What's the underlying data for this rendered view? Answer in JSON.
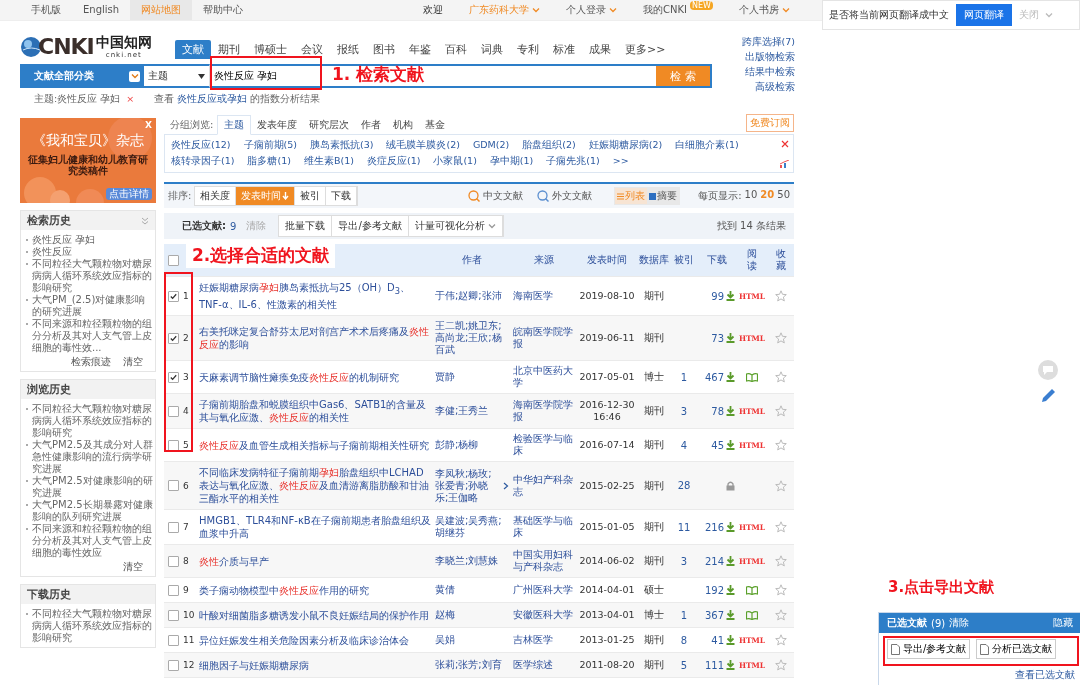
{
  "top_bar": {
    "left": [
      {
        "label": "手机版",
        "selected": false
      },
      {
        "label": "English",
        "selected": false
      },
      {
        "label": "网站地图",
        "selected": true
      },
      {
        "label": "帮助中心",
        "selected": false
      }
    ],
    "welcome": "欢迎",
    "right": [
      {
        "label": "广东药科大学",
        "kind": "org"
      },
      {
        "label": "个人登录",
        "kind": "menu"
      },
      {
        "label": "我的CNKI",
        "kind": "badge",
        "badge": "NEW"
      },
      {
        "label": "个人书房",
        "kind": "menu"
      }
    ]
  },
  "translate_bar": {
    "prompt": "是否将当前网页翻译成中文",
    "button": "网页翻译",
    "close": "关闭"
  },
  "logo": {
    "mark": "CNKI",
    "name": "中国知网",
    "domain": "cnki.net"
  },
  "nav_tabs": [
    {
      "label": "文献",
      "selected": true
    },
    {
      "label": "期刊",
      "selected": false
    },
    {
      "label": "博硕士",
      "selected": false
    },
    {
      "label": "会议",
      "selected": false
    },
    {
      "label": "报纸",
      "selected": false
    },
    {
      "label": "图书",
      "selected": false
    },
    {
      "label": "年鉴",
      "selected": false
    },
    {
      "label": "百科",
      "selected": false
    },
    {
      "label": "词典",
      "selected": false
    },
    {
      "label": "专利",
      "selected": false
    },
    {
      "label": "标准",
      "selected": false
    },
    {
      "label": "成果",
      "selected": false
    },
    {
      "label": "更多>>",
      "selected": false
    }
  ],
  "side_links": [
    "跨库选择(7)",
    "出版物检索",
    "结果中检索",
    "高级检索"
  ],
  "search": {
    "category": "文献全部分类",
    "field": "主题",
    "value": "炎性反应 孕妇",
    "button": "检 索"
  },
  "query_line": {
    "tag": "主题:炎性反应 孕妇",
    "remove": "×",
    "prefix": "查看",
    "link": "炎性反应或孕妇",
    "suffix": "的指数分析结果"
  },
  "ad": {
    "title": "《我和宝贝》杂志",
    "subtitle": "征集妇儿健康和幼儿教育研究类稿件",
    "button": "点击详情",
    "close": "X"
  },
  "history_panels": [
    {
      "title": "检索历史",
      "collapsible": true,
      "items": [
        "炎性反应 孕妇",
        "炎性反应",
        "不同粒径大气颗粒物对糖尿病病人循环系统效应指标的影响研究",
        "大气PM_(2.5)对健康影响的研究进展",
        "不同来源和粒径颗粒物的组分分析及其对人支气管上皮细胞的毒性效..."
      ],
      "footer": [
        "检索痕迹",
        "清空"
      ]
    },
    {
      "title": "浏览历史",
      "collapsible": false,
      "items": [
        "不同粒径大气颗粒物对糖尿病病人循环系统效应指标的影响研究",
        "大气PM2.5及其成分对人群急性健康影响的流行病学研究进展",
        "大气PM2.5对健康影响的研究进展",
        "大气PM2.5长期暴露对健康影响的队列研究进展",
        "不同来源和粒径颗粒物的组分分析及其对人支气管上皮细胞的毒性效应"
      ],
      "footer": [
        "清空"
      ]
    },
    {
      "title": "下载历史",
      "collapsible": false,
      "items": [
        "不同粒径大气颗粒物对糖尿病病人循环系统效应指标的影响研究"
      ]
    }
  ],
  "group_browse": {
    "label": "分组浏览:",
    "tabs": [
      {
        "label": "主题",
        "selected": true
      },
      {
        "label": "发表年度",
        "selected": false
      },
      {
        "label": "研究层次",
        "selected": false
      },
      {
        "label": "作者",
        "selected": false
      },
      {
        "label": "机构",
        "selected": false
      },
      {
        "label": "基金",
        "selected": false
      }
    ],
    "subscribe": "免费订阅",
    "tags": [
      "炎性反应(12)",
      "子痫前期(5)",
      "胰岛素抵抗(3)",
      "绒毛膜羊膜炎(2)",
      "GDM(2)",
      "胎盘组织(2)",
      "妊娠期糖尿病(2)",
      "白细胞介素(1)",
      "核转录因子(1)",
      "脂多糖(1)",
      "维生素B(1)",
      "炎症反应(1)",
      "小家鼠(1)",
      "孕中期(1)",
      "子痫先兆(1)"
    ],
    "more": ">>"
  },
  "sort_bar": {
    "label": "排序:",
    "options": [
      {
        "label": "相关度",
        "selected": false
      },
      {
        "label": "发表时间",
        "selected": true
      },
      {
        "label": "被引",
        "selected": false
      },
      {
        "label": "下载",
        "selected": false
      }
    ],
    "sources": [
      "中文文献",
      "外文文献"
    ],
    "views": [
      {
        "label": "列表",
        "selected": true
      },
      {
        "label": "摘要",
        "selected": false
      }
    ],
    "page_size_label": "每页显示:",
    "page_sizes": [
      {
        "label": "10",
        "selected": false
      },
      {
        "label": "20",
        "selected": true
      },
      {
        "label": "50",
        "selected": false
      }
    ]
  },
  "selection_bar": {
    "label": "已选文献:",
    "count": "9",
    "clear": "清除",
    "actions": [
      {
        "label": "批量下载",
        "dropdown": false
      },
      {
        "label": "导出/参考文献",
        "dropdown": false
      },
      {
        "label": "计量可视化分析",
        "dropdown": true
      }
    ],
    "result": "找到 14 条结果"
  },
  "table": {
    "select_all_checked": false,
    "columns": [
      "作者",
      "来源",
      "发表时间",
      "数据库",
      "被引",
      "下载",
      "阅读",
      "收藏"
    ],
    "rows": [
      {
        "number": "1",
        "checked": true,
        "title": [
          {
            "text": "妊娠期糖尿病",
            "highlighted": false
          },
          {
            "text": "孕妇",
            "highlighted": true
          },
          {
            "text": "胰岛素抵抗与25（OH）D$_{3}$、TNF-α、IL-6、性激素的相关性",
            "highlighted": false
          }
        ],
        "authors": "于伟;赵卿;张沛",
        "more_authors": false,
        "source": "海南医学",
        "date": "2019-08-10",
        "database": "期刊",
        "citations": "",
        "downloads": "99",
        "reader": {
          "kind": "html",
          "label": "HTML"
        }
      },
      {
        "number": "2",
        "checked": true,
        "title": [
          {
            "text": "右美托咪定复合舒芬太尼对剖宫产术术后疼痛及",
            "highlighted": false
          },
          {
            "text": "炎性反应",
            "highlighted": true
          },
          {
            "text": "的影响",
            "highlighted": false
          }
        ],
        "authors": "王二凯;姚卫东;高尚龙;王欣;杨百武",
        "more_authors": false,
        "source": "皖南医学院学报",
        "date": "2019-06-11",
        "database": "期刊",
        "citations": "",
        "downloads": "73",
        "reader": {
          "kind": "html",
          "label": "HTML"
        }
      },
      {
        "number": "3",
        "checked": true,
        "title": [
          {
            "text": "天麻素调节脑性瘫痪免疫",
            "highlighted": false
          },
          {
            "text": "炎性反应",
            "highlighted": true
          },
          {
            "text": "的机制研究",
            "highlighted": false
          }
        ],
        "authors": "贾静",
        "more_authors": false,
        "source": "北京中医药大学",
        "date": "2017-05-01",
        "database": "博士",
        "citations": "1",
        "downloads": "467",
        "reader": {
          "kind": "book"
        }
      },
      {
        "number": "4",
        "checked": false,
        "title": [
          {
            "text": "子痫前期胎盘和蜕膜组织中Gas6、SATB1的含量及其与氧化应激、",
            "highlighted": false
          },
          {
            "text": "炎性反应",
            "highlighted": true
          },
          {
            "text": "的相关性",
            "highlighted": false
          }
        ],
        "authors": "李健;王秀兰",
        "more_authors": false,
        "source": "海南医学院学报",
        "date": "2016-12-30 16:46",
        "database": "期刊",
        "citations": "3",
        "downloads": "78",
        "reader": {
          "kind": "html",
          "label": "HTML"
        }
      },
      {
        "number": "5",
        "checked": false,
        "title": [
          {
            "text": "炎性反应",
            "highlighted": true
          },
          {
            "text": "及血管生成相关指标与子痫前期相关性研究",
            "highlighted": false
          }
        ],
        "authors": "彭静;杨柳",
        "more_authors": false,
        "source": "检验医学与临床",
        "date": "2016-07-14",
        "database": "期刊",
        "citations": "4",
        "downloads": "45",
        "reader": {
          "kind": "html",
          "label": "HTML"
        }
      },
      {
        "number": "6",
        "checked": false,
        "title": [
          {
            "text": "不同临床发病特征子痫前期",
            "highlighted": false
          },
          {
            "text": "孕妇",
            "highlighted": true
          },
          {
            "text": "胎盘组织中LCHAD表达与氧化应激、",
            "highlighted": false
          },
          {
            "text": "炎性反应",
            "highlighted": true
          },
          {
            "text": "及血清游离脂肪酸和甘油三酯水平的相关性",
            "highlighted": false
          }
        ],
        "authors": "李凤秋;杨玫;张爱青;孙晓乐;王伽略",
        "more_authors": true,
        "source": "中华妇产科杂志",
        "date": "2015-02-25",
        "database": "期刊",
        "citations": "28",
        "downloads": "",
        "reader": {
          "kind": "lock"
        }
      },
      {
        "number": "7",
        "checked": false,
        "title": [
          {
            "text": "HMGB1、TLR4和NF-κB在子痫前期患者胎盘组织及血浆中升高",
            "highlighted": false
          }
        ],
        "authors": "吴建波;吴秀燕;胡继芬",
        "more_authors": false,
        "source": "基础医学与临床",
        "date": "2015-01-05",
        "database": "期刊",
        "citations": "11",
        "downloads": "216",
        "reader": {
          "kind": "html",
          "label": "HTML"
        }
      },
      {
        "number": "8",
        "checked": false,
        "title": [
          {
            "text": "炎性",
            "highlighted": true
          },
          {
            "text": "介质与早产",
            "highlighted": false
          }
        ],
        "authors": "李晓兰;刘慧姝",
        "more_authors": false,
        "source": "中国实用妇科与产科杂志",
        "date": "2014-06-02",
        "database": "期刊",
        "citations": "3",
        "downloads": "214",
        "reader": {
          "kind": "html",
          "label": "HTML"
        }
      },
      {
        "number": "9",
        "checked": false,
        "title": [
          {
            "text": "类子痫动物模型中",
            "highlighted": false
          },
          {
            "text": "炎性反应",
            "highlighted": true
          },
          {
            "text": "作用的研究",
            "highlighted": false
          }
        ],
        "authors": "黄倩",
        "more_authors": false,
        "source": "广州医科大学",
        "date": "2014-04-01",
        "database": "硕士",
        "citations": "",
        "downloads": "192",
        "reader": {
          "kind": "book"
        }
      },
      {
        "number": "10",
        "checked": false,
        "title": [
          {
            "text": "叶酸对细菌脂多糖诱发小鼠不良妊娠结局的保护作用",
            "highlighted": false
          }
        ],
        "authors": "赵梅",
        "more_authors": false,
        "source": "安徽医科大学",
        "date": "2013-04-01",
        "database": "博士",
        "citations": "1",
        "downloads": "367",
        "reader": {
          "kind": "book"
        }
      },
      {
        "number": "11",
        "checked": false,
        "title": [
          {
            "text": "异位妊娠发生相关危险因素分析及临床诊治体会",
            "highlighted": false
          }
        ],
        "authors": "吴娟",
        "more_authors": false,
        "source": "吉林医学",
        "date": "2013-01-25",
        "database": "期刊",
        "citations": "8",
        "downloads": "41",
        "reader": {
          "kind": "html",
          "label": "HTML"
        }
      },
      {
        "number": "12",
        "checked": false,
        "title": [
          {
            "text": "细胞因子与妊娠期糖尿病",
            "highlighted": false
          }
        ],
        "authors": "张莉;张芳;刘育",
        "more_authors": false,
        "source": "医学综述",
        "date": "2011-08-20",
        "database": "期刊",
        "citations": "5",
        "downloads": "111",
        "reader": {
          "kind": "html",
          "label": "HTML"
        }
      }
    ]
  },
  "annotations": [
    {
      "text": "1. 检索文献"
    },
    {
      "text": "2.选择合适的文献"
    },
    {
      "text": "3.点击导出文献"
    }
  ],
  "selected_panel": {
    "title": "已选文献",
    "count": "(9)",
    "clear": "清除",
    "hide": "隐藏",
    "buttons": [
      "导出/参考文献",
      "分析已选文献"
    ],
    "link": "查看已选文献"
  }
}
